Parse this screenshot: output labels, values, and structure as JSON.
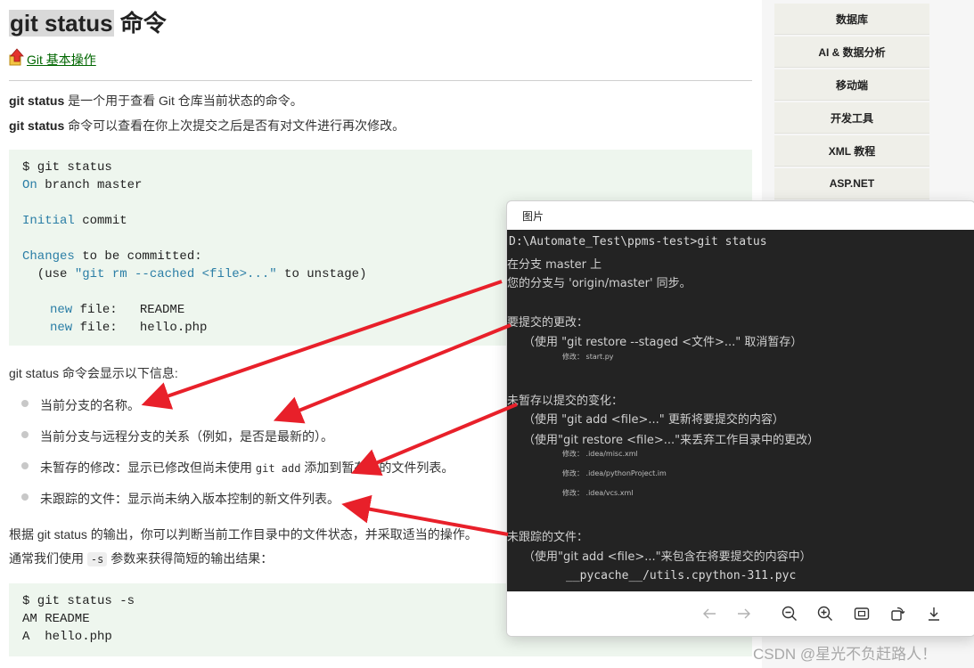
{
  "article": {
    "title_highlight": "git status",
    "title_rest": " 命令",
    "breadcrumb_link": "Git 基本操作",
    "intro": [
      {
        "bold": "git status",
        "text": " 是一个用于查看 Git 仓库当前状态的命令。"
      },
      {
        "bold": "git status",
        "text": " 命令可以查看在你上次提交之后是否有对文件进行再次修改。"
      }
    ],
    "code1": {
      "l1": "$ git status",
      "l2_kw": "On",
      "l2_rest": " branch master",
      "l4_kw": "Initial",
      "l4_rest": " commit",
      "l6_kw": "Changes",
      "l6_rest": " to be committed:",
      "l7_a": "  (use ",
      "l7_str": "\"git rm --cached <file>...\"",
      "l7_b": " to unstage)",
      "l9_kw": "new",
      "l9_rest": " file:   README",
      "l10_kw": "new",
      "l10_rest": " file:   hello.php"
    },
    "info_heading": "git status 命令会显示以下信息:",
    "list": [
      {
        "text": "当前分支的名称。"
      },
      {
        "text": "当前分支与远程分支的关系（例如，是否是最新的）。"
      },
      {
        "pre": "未暂存的修改：显示已修改但尚未使用 ",
        "code": "git add",
        "post": " 添加到暂存区的文件列表。"
      },
      {
        "text": "未跟踪的文件：显示尚未纳入版本控制的新文件列表。"
      }
    ],
    "para_output": "根据 git status 的输出，你可以判断当前工作目录中的文件状态，并采取适当的操作。",
    "para_short_pre": "通常我们使用 ",
    "para_short_code": "-s",
    "para_short_post": " 参数来获得简短的输出结果：",
    "code2": [
      "$ git status -s",
      "AM README",
      "A  hello.php"
    ]
  },
  "sidebar": {
    "items": [
      "数据库",
      "AI & 数据分析",
      "移动端",
      "开发工具",
      "XML 教程",
      "ASP.NET"
    ]
  },
  "viewer": {
    "title": "图片",
    "terminal": {
      "cmd": "D:\\Automate_Test\\ppms-test>git status",
      "branch": "在分支 master 上",
      "sync": "您的分支与 'origin/master' 同步。",
      "staged_heading": "要提交的更改：",
      "staged_hint": "（使用 \"git restore --staged <文件>...\" 取消暂存）",
      "staged_file": "修改：  start.py",
      "unstaged_heading": "未暂存以提交的变化：",
      "unstaged_hint1": "（使用 \"git add <file>...\" 更新将要提交的内容）",
      "unstaged_hint2": "（使用\"git restore <file>...\"来丢弃工作目录中的更改）",
      "unstaged_files": [
        "修改：  .idea/misc.xml",
        "修改：  .idea/pythonProject.im",
        "修改：  .idea/vcs.xml"
      ],
      "untracked_heading": "未跟踪的文件：",
      "untracked_hint": "（使用\"git add <file>...\"来包含在将要提交的内容中）",
      "untracked_file": "__pycache__/utils.cpython-311.pyc"
    }
  },
  "watermark": "CSDN @星光不负赶路人！",
  "colors": {
    "link": "#006600",
    "code_bg": "#eef6ee",
    "keyword": "#2b7ea6",
    "arrow": "#e8202a",
    "terminal_bg": "#232323"
  }
}
